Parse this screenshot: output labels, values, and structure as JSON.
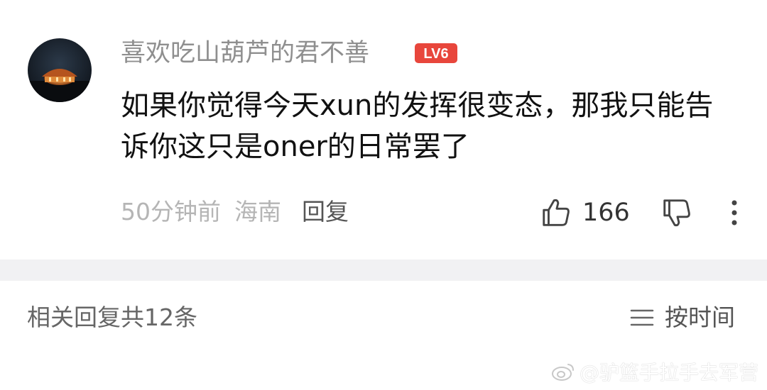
{
  "comment": {
    "username": "喜欢吃山葫芦的君不善",
    "level_badge": "LV6",
    "text": "如果你觉得今天xun的发挥很变态，那我只能告诉你这只是oner的日常罢了",
    "time": "50分钟前",
    "location": "海南",
    "reply_label": "回复",
    "like_count": "166"
  },
  "replies": {
    "count_label": "相关回复共12条",
    "sort_label": "按时间"
  },
  "watermark": "@驴篮手拉手去军营",
  "colors": {
    "badge_red": "#e8463c",
    "divider": "#f1f1f3",
    "text_primary": "#111111",
    "text_secondary": "#8f8f8f"
  },
  "icons": {
    "like": "thumbs-up-icon",
    "dislike": "thumbs-down-icon",
    "more": "more-vertical-icon",
    "sort": "sort-lines-icon",
    "watermark": "weibo-icon"
  }
}
